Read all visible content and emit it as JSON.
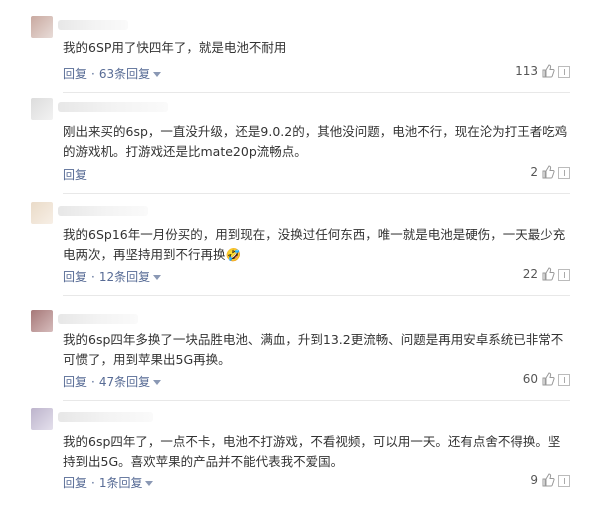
{
  "comments": [
    {
      "text": "我的6SP用了快四年了，就是电池不耐用",
      "reply_label": "回复",
      "replies": "63条回复",
      "likes": "113",
      "avatar_color": "#d9c7c2"
    },
    {
      "text": "刚出来买的6sp，一直没升级，还是9.0.2的，其他没问题，电池不行，现在沦为打王者吃鸡的游戏机。打游戏还是比mate20p流畅点。",
      "reply_label": "回复",
      "replies": "",
      "likes": "2",
      "avatar_color": "#e6e6e6"
    },
    {
      "text": "我的6Sp16年一月份买的，用到现在，没换过任何东西，唯一就是电池是硬伤，一天最少充电两次，再坚持用到不行再换🤣",
      "reply_label": "回复",
      "replies": "12条回复",
      "likes": "22",
      "avatar_color": "#f1e5d6"
    },
    {
      "text": "我的6sp四年多换了一块品胜电池、满血，升到13.2更流畅、问题是再用安卓系统已非常不可惯了，用到苹果出5G再换。",
      "reply_label": "回复",
      "replies": "47条回复",
      "likes": "60",
      "avatar_color": "#b78e8e"
    },
    {
      "text": "我的6sp四年了，一点不卡，电池不打游戏，不看视频，可以用一天。还有点舍不得换。坚持到出5G。喜欢苹果的产品并不能代表我不爱国。",
      "reply_label": "回复",
      "replies": "1条回复",
      "likes": "9",
      "avatar_color": "#c9c2d6"
    }
  ],
  "colors": {
    "link": "#576b95",
    "text": "#333333",
    "divider": "#e8e8e8"
  },
  "icons": {
    "like": "thumbs-up-icon",
    "report": "report-icon",
    "expand": "caret-down-icon"
  }
}
